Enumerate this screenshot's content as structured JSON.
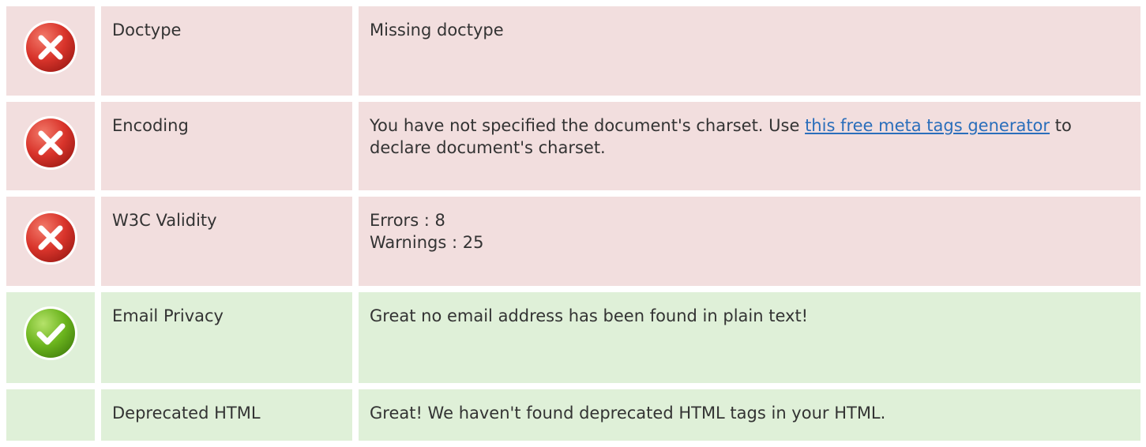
{
  "colors": {
    "error_bg": "#f2dede",
    "success_bg": "#dff0d8",
    "error_icon": "#d9342b",
    "success_icon": "#6cb51e",
    "link": "#2a6ebb"
  },
  "rows": [
    {
      "status": "error",
      "icon": "error-x-icon",
      "label": "Doctype",
      "value": "Missing doctype"
    },
    {
      "status": "error",
      "icon": "error-x-icon",
      "label": "Encoding",
      "value_prefix": "You have not specified the document's charset. Use ",
      "value_link": "this free meta tags generator",
      "value_suffix": " to declare document's charset."
    },
    {
      "status": "error",
      "icon": "error-x-icon",
      "label": "W3C Validity",
      "errors": "Errors : 8",
      "warnings": "Warnings : 25"
    },
    {
      "status": "success",
      "icon": "success-check-icon",
      "label": "Email Privacy",
      "value": "Great no email address has been found in plain text!"
    },
    {
      "status": "success",
      "icon": "",
      "label": "Deprecated HTML",
      "value": "Great! We haven't found deprecated HTML tags in your HTML."
    }
  ]
}
